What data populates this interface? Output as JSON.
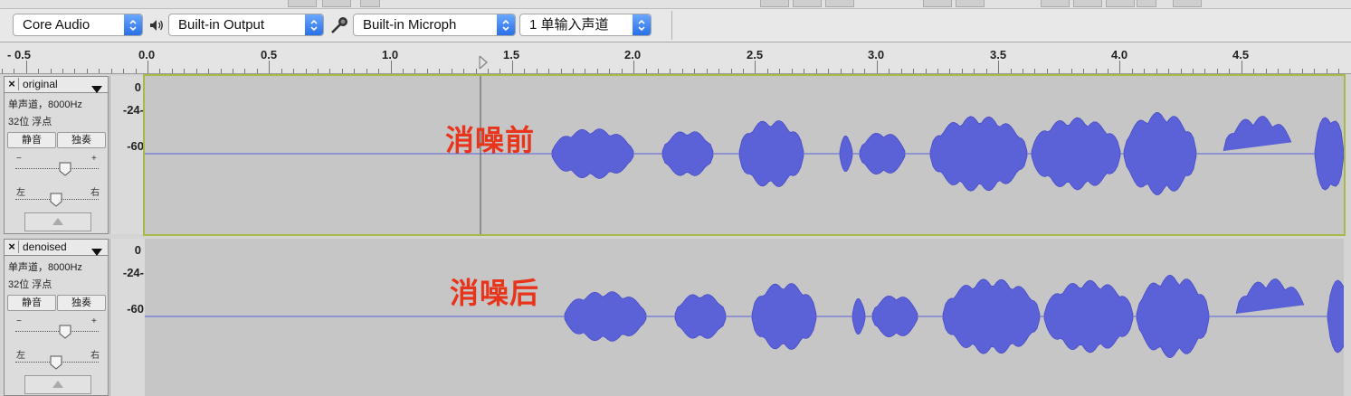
{
  "device_bar": {
    "host": "Core Audio",
    "output_device": "Built-in Output",
    "input_device": "Built-in Microph",
    "input_channels": "1 单输入声道"
  },
  "ruler": {
    "labels": [
      "- 0.5",
      "0.0",
      "0.5",
      "1.0",
      "1.5",
      "2.0",
      "2.5",
      "3.0",
      "3.5",
      "4.0",
      "4.5"
    ]
  },
  "tracks": [
    {
      "name": "original",
      "info_line1": "单声道，8000Hz",
      "info_line2": "32位 浮点",
      "mute_label": "静音",
      "solo_label": "独奏",
      "gain_minus": "−",
      "gain_plus": "+",
      "pan_left": "左",
      "pan_right": "右",
      "scale": [
        "0",
        "-24-",
        "-60"
      ],
      "annotation": "消噪前"
    },
    {
      "name": "denoised",
      "info_line1": "单声道，8000Hz",
      "info_line2": "32位 浮点",
      "mute_label": "静音",
      "solo_label": "独奏",
      "gain_minus": "−",
      "gain_plus": "+",
      "pan_left": "左",
      "pan_right": "右",
      "scale": [
        "0",
        "-24-",
        "-60"
      ],
      "annotation": "消噪后"
    }
  ],
  "colors": {
    "waveform": "#5b61d6",
    "waveform_edge": "#3b40c4",
    "annotation": "#e8341b",
    "selected_track_border": "#a9b84a",
    "select_arrow": "#2a70e8"
  }
}
